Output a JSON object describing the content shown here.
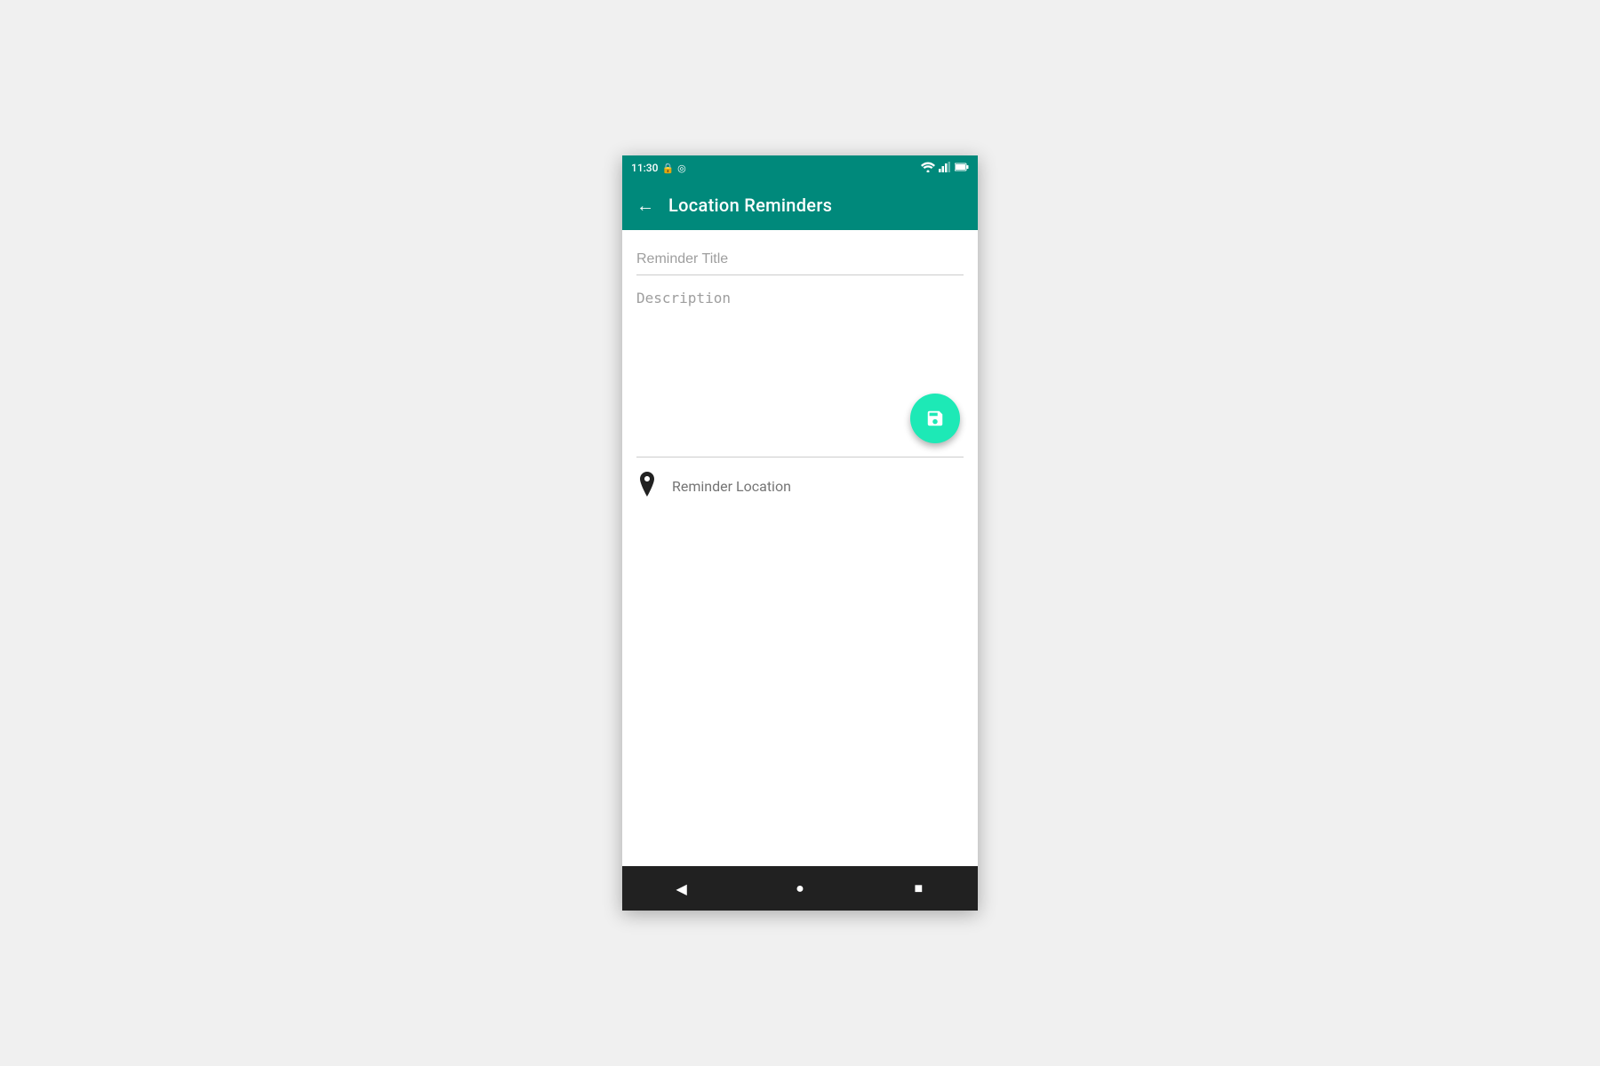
{
  "statusBar": {
    "time": "11:30",
    "battery_icon": "battery",
    "location_icon": "location",
    "wifi_icon": "wifi",
    "signal_icon": "signal",
    "battery_full_icon": "battery-full"
  },
  "appBar": {
    "back_label": "←",
    "title": "Location Reminders"
  },
  "form": {
    "title_placeholder": "Reminder Title",
    "description_placeholder": "Description",
    "location_label": "Reminder Location"
  },
  "fab": {
    "label": "Save",
    "icon": "save-icon"
  },
  "navBar": {
    "back_btn": "◀",
    "home_btn": "●",
    "recents_btn": "■"
  }
}
